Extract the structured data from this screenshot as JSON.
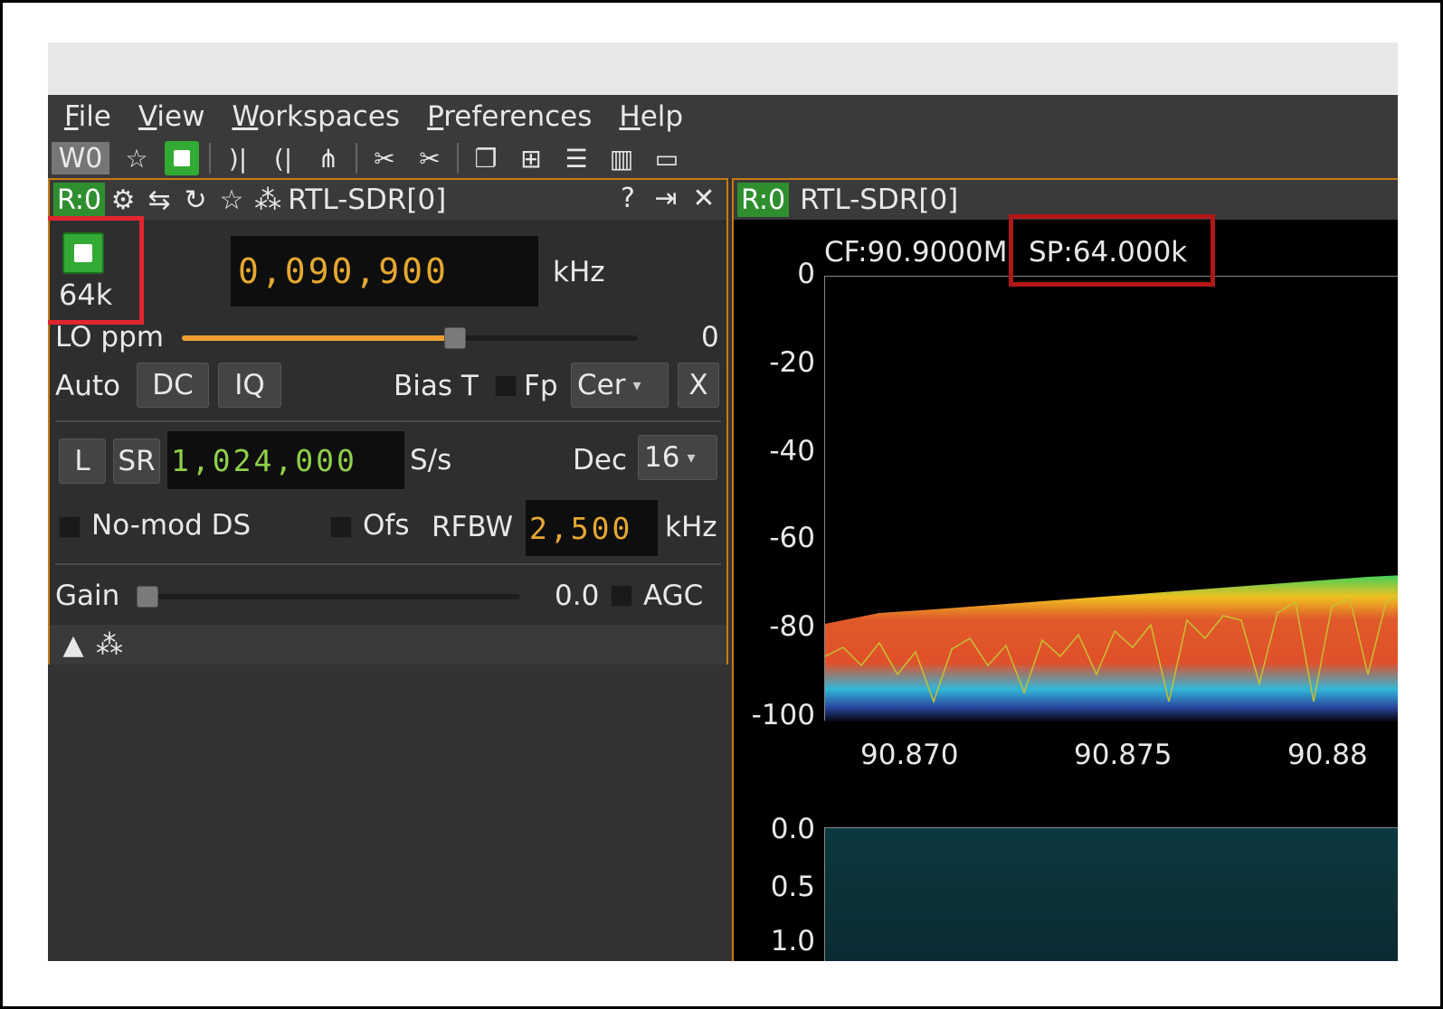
{
  "menu": [
    "File",
    "View",
    "Workspaces",
    "Preferences",
    "Help"
  ],
  "menu_mnemonics": [
    "F",
    "V",
    "W",
    "P",
    "H"
  ],
  "toolbar": {
    "workspace": "W0"
  },
  "device": {
    "rx_tag": "R:0",
    "name": "RTL-SDR[0]",
    "sample_rate_label": "64k",
    "center_freq_digits": "0,090,900",
    "center_freq_unit": "kHz",
    "lo_ppm_label": "LO ppm",
    "lo_ppm_value": "0",
    "auto_label": "Auto",
    "dc_label": "DC",
    "iq_label": "IQ",
    "bias_t_label": "Bias T",
    "fp_label": "Fp",
    "fp_select": "Cer",
    "x_label": "X",
    "l_label": "L",
    "sr_label": "SR",
    "sr_digits": "1,024,000",
    "sr_unit": "S/s",
    "dec_label": "Dec",
    "dec_select": "16",
    "nomod_label": "No-mod DS",
    "ofs_label": "Ofs",
    "rfbw_label": "RFBW",
    "rfbw_digits": "2,500",
    "rfbw_unit": "kHz",
    "gain_label": "Gain",
    "gain_value": "0.0",
    "agc_label": "AGC",
    "lo_ppm_slider_level": 0.6,
    "gain_slider_level": 0.0
  },
  "spectrum": {
    "rx_tag": "R:0",
    "name": "RTL-SDR[0]",
    "cf_text": "CF:90.9000M",
    "sp_text": "SP:64.000k",
    "y_ticks": [
      "0",
      "-20",
      "-40",
      "-60",
      "-80",
      "-100"
    ],
    "x_ticks": [
      "90.870",
      "90.875",
      "90.88"
    ],
    "wf_ticks": [
      "0.0",
      "0.5",
      "1.0"
    ]
  },
  "colors": {
    "accent": "#c77a12",
    "run_green": "#33aa33",
    "highlight_red": "#e0262e"
  }
}
